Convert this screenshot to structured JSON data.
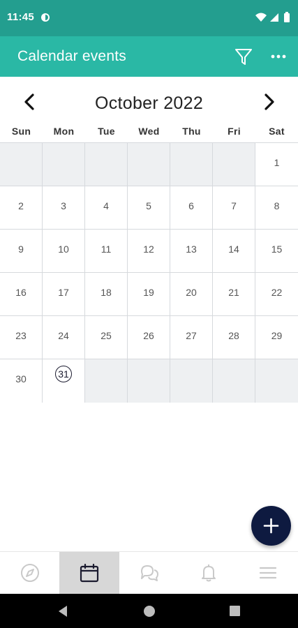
{
  "status_bar": {
    "time": "11:45",
    "app_icon": "data-saver-icon",
    "icons": [
      "wifi-icon",
      "signal-icon",
      "battery-icon"
    ]
  },
  "app_bar": {
    "title": "Calendar events",
    "background": "#2ab8a5",
    "status_background": "#239e8f",
    "actions": [
      "filter-icon",
      "more-options-icon"
    ]
  },
  "calendar": {
    "month_label": "October 2022",
    "prev_icon": "chevron-left-icon",
    "next_icon": "chevron-right-icon",
    "weekdays": [
      "Sun",
      "Mon",
      "Tue",
      "Wed",
      "Thu",
      "Fri",
      "Sat"
    ],
    "days": [
      "",
      "",
      "",
      "",
      "",
      "",
      "1",
      "2",
      "3",
      "4",
      "5",
      "6",
      "7",
      "8",
      "9",
      "10",
      "11",
      "12",
      "13",
      "14",
      "15",
      "16",
      "17",
      "18",
      "19",
      "20",
      "21",
      "22",
      "23",
      "24",
      "25",
      "26",
      "27",
      "28",
      "29",
      "30",
      "31",
      "",
      "",
      "",
      "",
      ""
    ],
    "today": "31"
  },
  "fab": {
    "icon": "plus-icon",
    "color": "#0e1a40"
  },
  "bottom_nav": {
    "items": [
      "compass-icon",
      "calendar-icon",
      "chat-bubbles-icon",
      "bell-icon",
      "menu-icon"
    ],
    "active": "calendar-icon"
  },
  "system_nav": {
    "items": [
      "back-icon",
      "home-icon",
      "recents-icon"
    ]
  }
}
